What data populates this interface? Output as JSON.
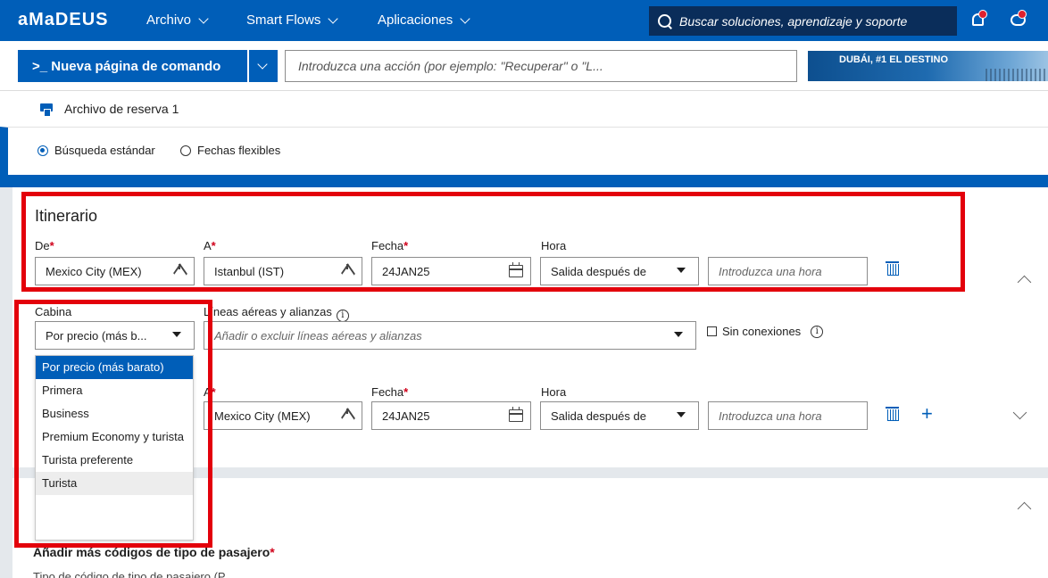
{
  "topbar": {
    "logo": "aMaDEUS",
    "menu": [
      "Archivo",
      "Smart Flows",
      "Aplicaciones"
    ],
    "search_placeholder": "Buscar soluciones, aprendizaje y soporte"
  },
  "command": {
    "button_label": ">_ Nueva página de comando",
    "input_placeholder": "Introduzca una acción (por ejemplo: \"Recuperar\" o \"L...",
    "banner_text": "DUBÁI, #1 EL DESTINO"
  },
  "file": {
    "label": "Archivo de reserva 1"
  },
  "search_type": {
    "standard": "Búsqueda estándar",
    "flexible": "Fechas flexibles",
    "selected": "standard"
  },
  "itinerary": {
    "title": "Itinerario",
    "labels": {
      "from": "De",
      "to": "A",
      "date": "Fecha",
      "time": "Hora",
      "required": "*"
    },
    "leg1": {
      "from": "Mexico City (MEX)",
      "to": "Istanbul (IST)",
      "date": "24JAN25",
      "time_mode": "Salida después de",
      "time_placeholder": "Introduzca una hora"
    },
    "leg2": {
      "to": "Mexico City (MEX)",
      "date": "24JAN25",
      "time_mode": "Salida después de",
      "time_placeholder": "Introduzca una hora"
    }
  },
  "cabin": {
    "label": "Cabina",
    "selected_display": "Por precio (más b...",
    "options": [
      "Por precio (más barato)",
      "Primera",
      "Business",
      "Premium Economy y turista",
      "Turista preferente",
      "Turista"
    ]
  },
  "airlines": {
    "label": "Líneas aéreas y alianzas",
    "placeholder": "Añadir o excluir líneas aéreas y alianzas"
  },
  "no_connections": {
    "label": "Sin conexiones"
  },
  "passengers": {
    "title": "Añadir más códigos de tipo de pasajero",
    "clipped_text": "Tipo de código de tipo de pasajero (P"
  },
  "colors": {
    "brand": "#005eb8",
    "highlight": "#e3000b",
    "required": "#d0021b"
  }
}
